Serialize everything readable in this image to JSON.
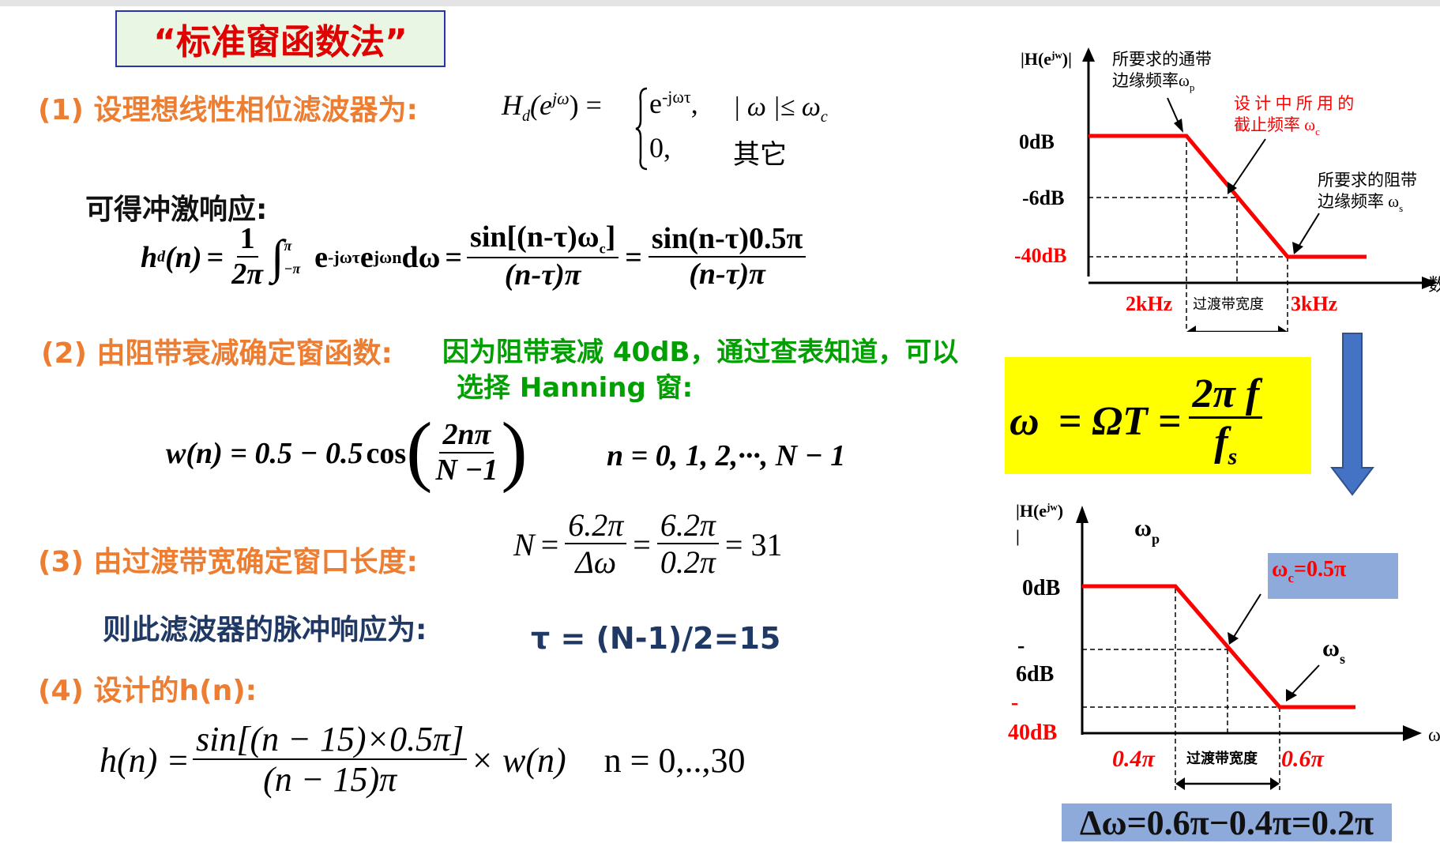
{
  "title": "“标准窗函数法”",
  "step1": {
    "label": "(1) 设理想线性相位滤波器为:",
    "eq_lhs": "H",
    "eq_lhs_sub": "d",
    "eq_lhs_arg": "(e",
    "eq_lhs_sup": "jω",
    "case1_val": "e",
    "case1_sup": "-jωτ",
    "case1_cond": "| ω |≤ ω",
    "case1_cond_sub": "c",
    "case2_val": "0,",
    "case2_cond": "其它"
  },
  "impulse": {
    "label": "可得冲激响应:",
    "lhs": "h",
    "frac1_num": "1",
    "frac1_den": "2π",
    "integrand": "e",
    "integrand_sup1": "-jωτ",
    "integrand_sup2": "jωn",
    "dw": "dω",
    "frac2_num": "sin[(n-τ)ω",
    "frac2_num_sub": "c",
    "frac2_den": "(n-τ)π",
    "frac3_num": "sin(n-τ)0.5π",
    "frac3_den": "(n-τ)π"
  },
  "step2": {
    "label": "(2) 由阻带衰减确定窗函数:",
    "note_line1": "因为阻带衰减 40dB，通过查表知道，可以",
    "note_line2": "选择 Hanning 窗:",
    "w_lhs": "w(n) = 0.5 − 0.5",
    "cos": "cos",
    "frac_num": "2nπ",
    "frac_den": "N −1",
    "range": "n = 0, 1, 2,···, N − 1"
  },
  "step3": {
    "label": "(3) 由过渡带宽确定窗口长度:",
    "n_lhs": "N",
    "frac1_num": "6.2π",
    "frac1_den": "Δω",
    "frac2_num": "6.2π",
    "frac2_den": "0.2π",
    "result": "= 31",
    "impulse_label": "则此滤波器的脉冲响应为:",
    "tau": "τ = (N-1)/2=15"
  },
  "step4": {
    "label": "(4) 设计的h(n):",
    "lhs": "h(n) =",
    "frac_num": "sin[(n − 15)×0.5π]",
    "frac_den": "(n − 15)π",
    "rhs": "× w(n)",
    "range": "n = 0,..,30"
  },
  "chart_top": {
    "ylabel": "|H(e",
    "ylabel_sup": "jw",
    "ylabel_end": ")|",
    "ticks": [
      "0dB",
      "-6dB",
      "-40dB"
    ],
    "x_ticks": [
      "2kHz",
      "3kHz"
    ],
    "band_label": "过渡带宽度",
    "x_cut": "数",
    "annot_pass_1": "所要求的通带",
    "annot_pass_2": "边缘频率ω",
    "annot_pass_sub": "p",
    "annot_cut_1": "设 计 中 所 用 的",
    "annot_cut_2": "截止频率 ω",
    "annot_cut_sub": "c",
    "annot_stop_1": "所要求的阻带",
    "annot_stop_2": "边缘频率 ω",
    "annot_stop_sub": "s"
  },
  "formula": {
    "lhs": "ω",
    "mid": "= ΩT =",
    "num": "2π f",
    "den": "f",
    "den_sub": "s"
  },
  "chart_bottom": {
    "ylabel_1": "|H(e",
    "ylabel_sup": "jw",
    "ylabel_2": ")",
    "ylabel_3": "|",
    "wp": "ω",
    "wp_sub": "p",
    "wc": "ω",
    "wc_sub": "c",
    "wc_val": "=0.5π",
    "ws": "ω",
    "ws_sub": "s",
    "tick0": "0dB",
    "tick6a": "-",
    "tick6b": "6dB",
    "tick40a": "-",
    "tick40b": "40dB",
    "x_ticks": [
      "0.4π",
      "0.6π"
    ],
    "band_label": "过渡带宽度",
    "x_cut": "ω"
  },
  "delta": "Δω=0.6π−0.4π=0.2π",
  "colors": {
    "red": "#ff0000",
    "orange": "#ed7d31",
    "green": "#00a000",
    "arrow_blue": "#4472c4",
    "highlight": "#ffff00",
    "blue_box": "#8eaadb"
  }
}
